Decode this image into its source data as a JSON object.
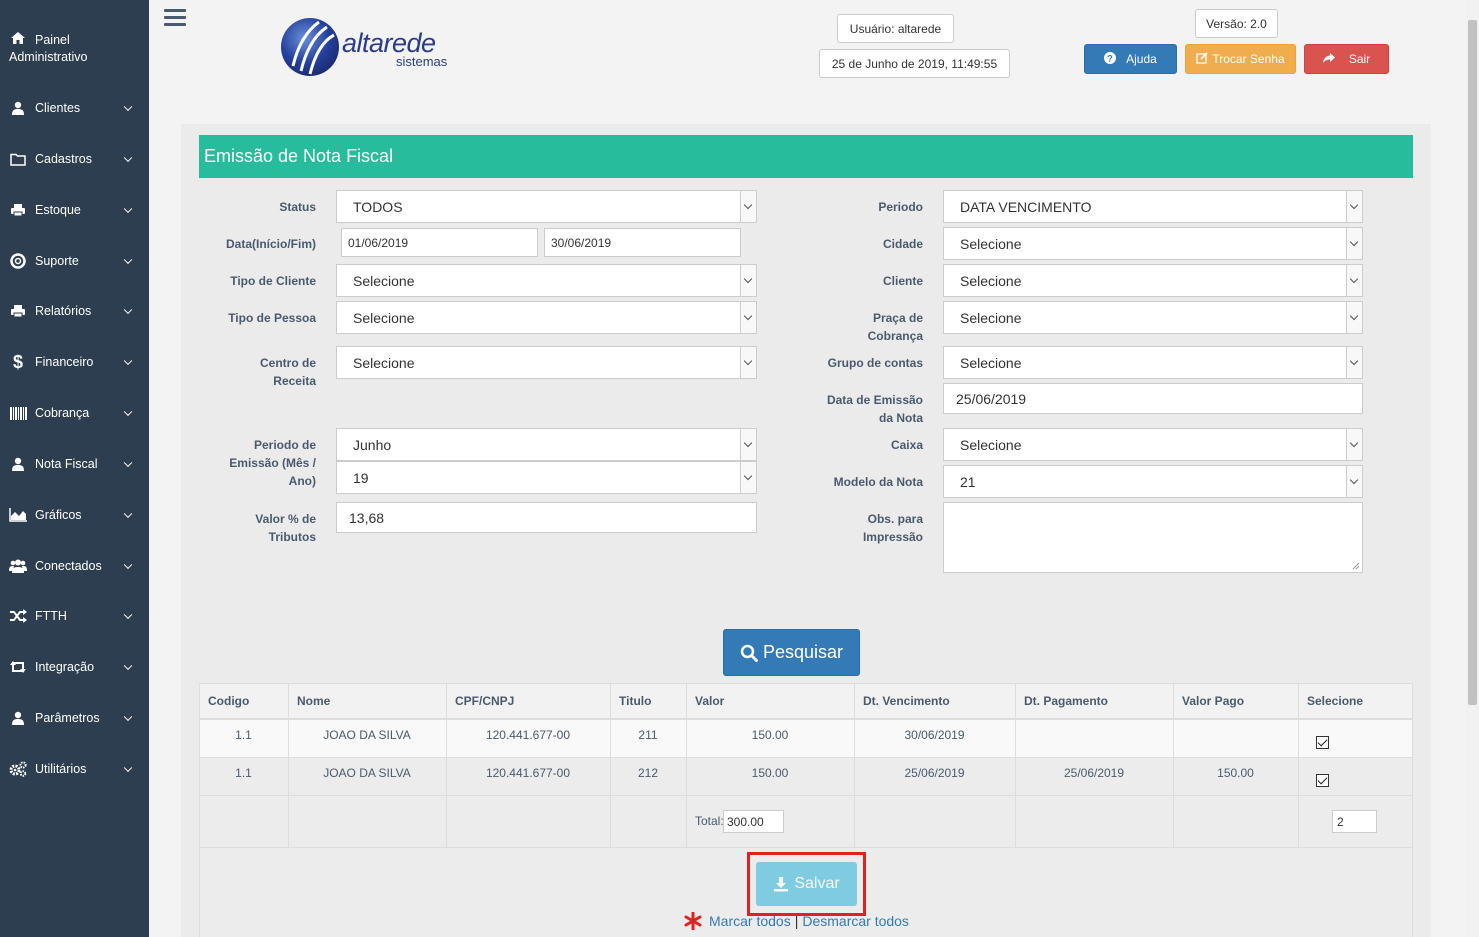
{
  "sidebar": {
    "items": [
      {
        "label_l1": "Painel",
        "label_l2": "Administrativo",
        "icon": "home-icon"
      },
      {
        "label": "Clientes",
        "icon": "user-icon"
      },
      {
        "label": "Cadastros",
        "icon": "folder-icon"
      },
      {
        "label": "Estoque",
        "icon": "print-icon"
      },
      {
        "label": "Suporte",
        "icon": "life-ring-icon"
      },
      {
        "label": "Relatórios",
        "icon": "print-icon"
      },
      {
        "label": "Financeiro",
        "icon": "dollar-icon"
      },
      {
        "label": "Cobrança",
        "icon": "barcode-icon"
      },
      {
        "label": "Nota Fiscal",
        "icon": "user-icon"
      },
      {
        "label": "Gráficos",
        "icon": "area-chart-icon"
      },
      {
        "label": "Conectados",
        "icon": "users-icon"
      },
      {
        "label": "FTTH",
        "icon": "random-icon"
      },
      {
        "label": "Integração",
        "icon": "retweet-icon"
      },
      {
        "label": "Parâmetros",
        "icon": "user-icon"
      },
      {
        "label": "Utilitários",
        "icon": "cogs-icon"
      }
    ]
  },
  "header": {
    "logo_text": "altarede",
    "logo_sub": "sistemas",
    "user": "Usuário: altarede",
    "datetime": "25 de Junho de 2019, 11:49:55",
    "version": "Versão: 2.0",
    "help": "Ajuda",
    "change_password": "Trocar Senha",
    "logout": "Sair"
  },
  "form": {
    "title": "Emissão de Nota Fiscal",
    "status_label": "Status",
    "status_value": "TODOS",
    "dates_label": "Data(Início/Fim)",
    "date_start": "01/06/2019",
    "date_end": "30/06/2019",
    "client_type_label": "Tipo de Cliente",
    "client_type_value": "Selecione",
    "person_type_label": "Tipo de Pessoa",
    "person_type_value": "Selecione",
    "revenue_center_label_l1": "Centro de",
    "revenue_center_label_l2": "Receita",
    "revenue_center_value": "Selecione",
    "emission_period_label_l1": "Periodo de",
    "emission_period_label_l2": "Emissão (Mês /",
    "emission_period_label_l3": "Ano)",
    "month_value": "Junho",
    "year_value": "19",
    "tax_label_l1": "Valor % de",
    "tax_label_l2": "Tributos",
    "tax_value": "13,68",
    "period_label": "Periodo",
    "period_value": "DATA VENCIMENTO",
    "city_label": "Cidade",
    "city_value": "Selecione",
    "client_label": "Cliente",
    "client_value": "Selecione",
    "billing_label_l1": "Praça de",
    "billing_label_l2": "Cobrança",
    "billing_value": "Selecione",
    "accounts_group_label": "Grupo de contas",
    "accounts_group_value": "Selecione",
    "emission_date_label_l1": "Data de Emissão",
    "emission_date_label_l2": "da Nota",
    "emission_date_value": "25/06/2019",
    "cashier_label": "Caixa",
    "cashier_value": "Selecione",
    "model_label": "Modelo da Nota",
    "model_value": "21",
    "obs_label_l1": "Obs. para",
    "obs_label_l2": "Impressão",
    "obs_value": "",
    "search_button": "Pesquisar"
  },
  "table": {
    "headers": [
      "Codigo",
      "Nome",
      "CPF/CNPJ",
      "Titulo",
      "Valor",
      "Dt. Vencimento",
      "Dt. Pagamento",
      "Valor Pago",
      "Selecione"
    ],
    "rows": [
      {
        "codigo": "1.1",
        "nome": "JOAO DA SILVA",
        "cpf": "120.441.677-00",
        "titulo": "211",
        "valor": "150.00",
        "vencimento": "30/06/2019",
        "pagamento": "",
        "valor_pago": "",
        "checked": true
      },
      {
        "codigo": "1.1",
        "nome": "JOAO DA SILVA",
        "cpf": "120.441.677-00",
        "titulo": "212",
        "valor": "150.00",
        "vencimento": "25/06/2019",
        "pagamento": "25/06/2019",
        "valor_pago": "150.00",
        "checked": true
      }
    ],
    "total_label": "Total:",
    "total_value": "300.00",
    "selected_count": "2"
  },
  "footer": {
    "save_button": "Salvar",
    "mark_all": "Marcar todos",
    "separator": "|",
    "unmark_all": "Desmarcar todos"
  },
  "colors": {
    "sidebar": "#2c3e50",
    "title_bar": "#26bc9c",
    "help": "#337ab7",
    "change_password": "#f0ad4e",
    "logout": "#d9534f",
    "save": "#5bc0de",
    "highlight": "#e0211f"
  }
}
